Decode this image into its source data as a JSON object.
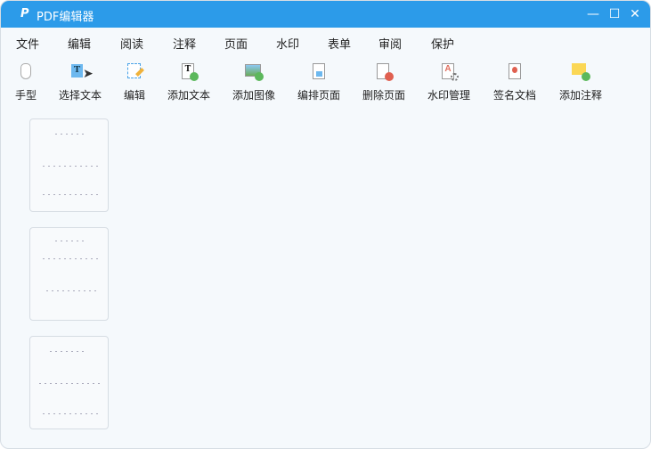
{
  "window": {
    "title": "PDF编辑器",
    "logo": "P"
  },
  "menu": [
    "文件",
    "编辑",
    "阅读",
    "注释",
    "页面",
    "水印",
    "表单",
    "审阅",
    "保护"
  ],
  "toolbar": [
    {
      "label": "手型",
      "icon": "hand-icon"
    },
    {
      "label": "选择文本",
      "icon": "select-text-icon"
    },
    {
      "label": "编辑",
      "icon": "edit-icon"
    },
    {
      "label": "添加文本",
      "icon": "add-text-icon"
    },
    {
      "label": "添加图像",
      "icon": "add-image-icon"
    },
    {
      "label": "编排页面",
      "icon": "arrange-pages-icon"
    },
    {
      "label": "删除页面",
      "icon": "delete-page-icon"
    },
    {
      "label": "水印管理",
      "icon": "watermark-icon"
    },
    {
      "label": "签名文档",
      "icon": "sign-icon"
    },
    {
      "label": "添加注释",
      "icon": "add-comment-icon"
    }
  ],
  "colors": {
    "titlebar": "#2c9be9",
    "accent_green": "#5cb85c"
  }
}
